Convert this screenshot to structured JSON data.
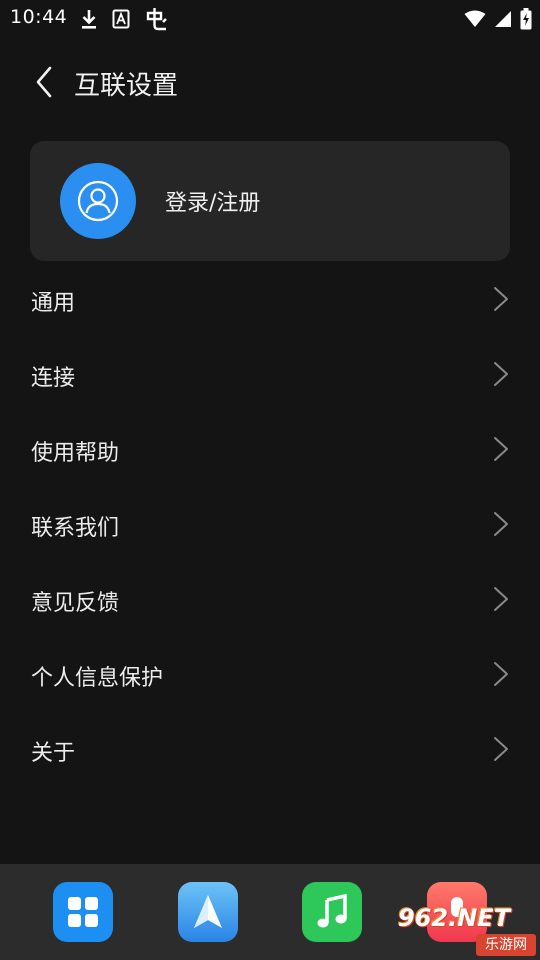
{
  "status_bar": {
    "time": "10:44",
    "icons": [
      "download-icon",
      "font-a-icon",
      "bug-app-icon",
      "wifi-icon",
      "cellular-icon",
      "battery-charging-icon"
    ]
  },
  "header": {
    "title": "互联设置",
    "back_icon": "chevron-left-icon"
  },
  "account": {
    "login_label": "登录/注册",
    "avatar_icon": "user-icon",
    "avatar_color": "#2a8ff0"
  },
  "menu": {
    "items": [
      {
        "label": "通用"
      },
      {
        "label": "连接"
      },
      {
        "label": "使用帮助"
      },
      {
        "label": "联系我们"
      },
      {
        "label": "意见反馈"
      },
      {
        "label": "个人信息保护"
      },
      {
        "label": "关于"
      }
    ]
  },
  "dock": {
    "apps": [
      {
        "icon": "app-grid-icon",
        "color": "#1d8ff3"
      },
      {
        "icon": "navigation-icon",
        "color": "#2b84e6"
      },
      {
        "icon": "music-icon",
        "color": "#2dc75a"
      },
      {
        "icon": "microphone-icon",
        "color": "#f0384f"
      }
    ]
  },
  "watermark": {
    "main": "962.NET",
    "sub": "乐游网"
  }
}
